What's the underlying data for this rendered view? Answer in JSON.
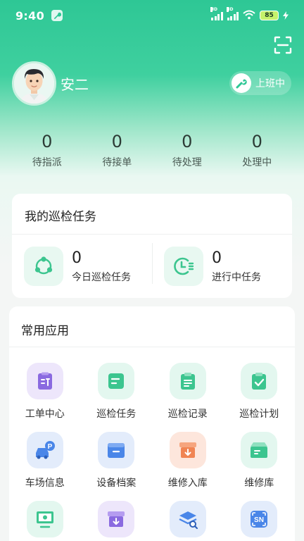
{
  "status_bar": {
    "time": "9:40",
    "battery_level": "85"
  },
  "profile": {
    "name": "安二",
    "duty_status": "上班中"
  },
  "stats": [
    {
      "value": "0",
      "label": "待指派"
    },
    {
      "value": "0",
      "label": "待接单"
    },
    {
      "value": "0",
      "label": "待处理"
    },
    {
      "value": "0",
      "label": "处理中"
    }
  ],
  "patrol": {
    "title": "我的巡检任务",
    "items": [
      {
        "value": "0",
        "label": "今日巡检任务",
        "icon": "share-nodes-icon"
      },
      {
        "value": "0",
        "label": "进行中任务",
        "icon": "clock-list-icon"
      }
    ]
  },
  "apps": {
    "title": "常用应用",
    "items": [
      {
        "label": "工单中心",
        "icon": "work-order-icon"
      },
      {
        "label": "巡检任务",
        "icon": "patrol-task-icon"
      },
      {
        "label": "巡检记录",
        "icon": "patrol-record-icon"
      },
      {
        "label": "巡检计划",
        "icon": "patrol-plan-icon"
      },
      {
        "label": "车场信息",
        "icon": "parking-icon"
      },
      {
        "label": "设备档案",
        "icon": "device-archive-icon"
      },
      {
        "label": "维修入库",
        "icon": "repair-inbound-icon"
      },
      {
        "label": "维修库",
        "icon": "repair-storage-icon"
      },
      {
        "label": "",
        "icon": "monitor-icon"
      },
      {
        "label": "",
        "icon": "archive-download-icon"
      },
      {
        "label": "",
        "icon": "layers-search-icon"
      },
      {
        "label": "",
        "icon": "sn-scan-icon",
        "text": "SN"
      }
    ]
  },
  "colors": {
    "accent": "#2ec795",
    "icon_green": "#3cc58f",
    "icon_purple": "#8a6ae0",
    "icon_blue": "#4a86e8",
    "icon_orange": "#f08453"
  }
}
